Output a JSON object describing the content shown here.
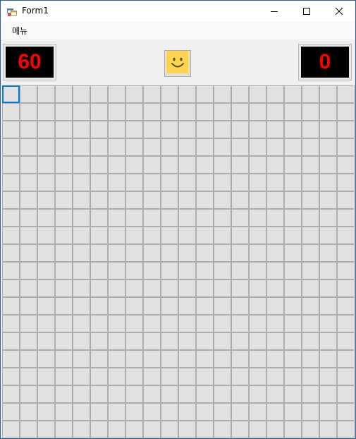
{
  "window": {
    "title": "Form1",
    "icon": "winforms-app-icon",
    "controls": [
      "minimize-icon",
      "maximize-icon",
      "close-icon"
    ]
  },
  "menu": {
    "items": [
      {
        "label": "메뉴"
      }
    ]
  },
  "game": {
    "mine_counter": "60",
    "timer": "0",
    "face": "smiley-face-icon",
    "board": {
      "rows": 20,
      "cols": 20,
      "focused_cell": {
        "row": 0,
        "col": 0
      }
    }
  },
  "colors": {
    "digit": "#ff0000",
    "display_bg": "#000000",
    "focus": "#0078d7",
    "face": "#ffd54f"
  }
}
